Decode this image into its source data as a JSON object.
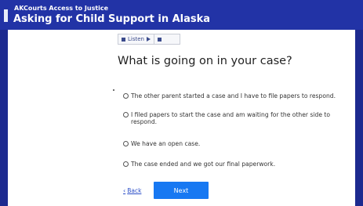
{
  "header": {
    "subtitle": "AKCourts Access to Justice",
    "title": "Asking for Child Support in Alaska"
  },
  "listen": {
    "listen_label": "Listen"
  },
  "question": "What is going on in your case?",
  "options": [
    "The other parent started a case and I have to file papers to respond.",
    "I filed papers to start the case and am waiting for the other side to respond.",
    "We have an open case.",
    "The case ended and we got our final paperwork."
  ],
  "nav": {
    "back_label": "Back",
    "next_label": "Next"
  },
  "colors": {
    "header_bg": "#2233a6",
    "next_button": "#1778f2",
    "link": "#2b4ec8"
  }
}
